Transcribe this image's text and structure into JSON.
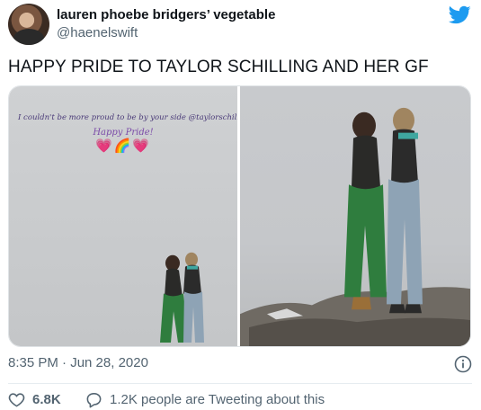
{
  "author": {
    "display_name": "lauren phoebe bridgers’ vegetable",
    "handle": "@haenelswift"
  },
  "tweet": {
    "text": "HAPPY PRIDE TO TAYLOR SCHILLING AND HER GF"
  },
  "media": {
    "overlay_caption": "I couldn't be more proud to be by your side @taylorschilling",
    "overlay_greeting": "Happy Pride!",
    "overlay_emoji": "💗🌈💗"
  },
  "meta": {
    "timestamp": "8:35 PM · Jun 28, 2020"
  },
  "engagement": {
    "likes": "6.8K",
    "comments_text": "1.2K people are Tweeting about this"
  },
  "colors": {
    "twitter_blue": "#1d9bf0",
    "muted_text": "#536471"
  },
  "icons": [
    "twitter-bird-icon",
    "info-icon",
    "heart-icon",
    "comment-icon"
  ]
}
